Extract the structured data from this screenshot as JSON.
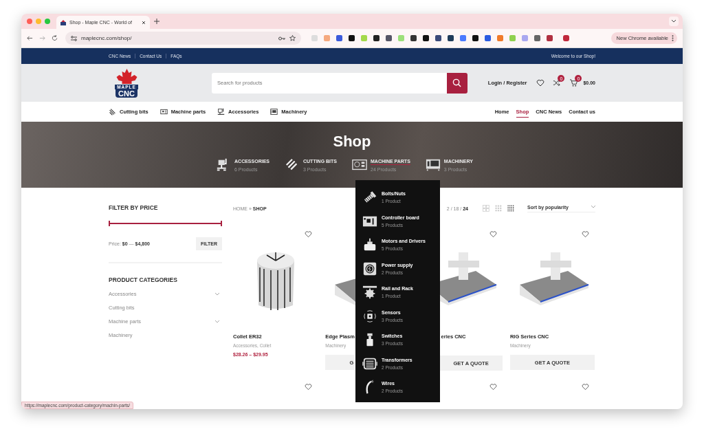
{
  "browser": {
    "tab_title": "Shop - Maple CNC - World of",
    "url": "maplecnc.com/shop/",
    "update_button": "New Chrome available"
  },
  "top_bar": {
    "links": [
      "CNC News",
      "Contact Us",
      "FAQs"
    ],
    "welcome": "Welcome to our Shop!"
  },
  "header": {
    "logo_top": "MAPLE",
    "logo_bottom": "CNC",
    "search": {
      "placeholder": "Search for products"
    },
    "account": "Login / Register",
    "compare_count": "0",
    "cart_count": "0",
    "cart_total": "$0.00"
  },
  "category_nav": [
    {
      "label": "Cutting bits"
    },
    {
      "label": "Machine parts"
    },
    {
      "label": "Accessories"
    },
    {
      "label": "Machinery"
    }
  ],
  "main_nav": [
    {
      "label": "Home",
      "selected": false
    },
    {
      "label": "Shop",
      "selected": true
    },
    {
      "label": "CNC News",
      "selected": false
    },
    {
      "label": "Contact us",
      "selected": false
    }
  ],
  "hero": {
    "title": "Shop",
    "categories": [
      {
        "name": "ACCESSORIES",
        "count": "6 Products",
        "selected": false
      },
      {
        "name": "CUTTING BITS",
        "count": "3 Products",
        "selected": false
      },
      {
        "name": "MACHINE PARTS",
        "count": "24 Products",
        "selected": true
      },
      {
        "name": "MACHINERY",
        "count": "3 Products",
        "selected": false
      }
    ]
  },
  "sidebar": {
    "filter_title": "FILTER BY PRICE",
    "range": {
      "level": 1
    },
    "price": "Price: **$0** — **$4,800**",
    "filter_button": "FILTER",
    "categories_title": "PRODUCT CATEGORIES",
    "categories": [
      {
        "label": "Accessories",
        "has_children": true
      },
      {
        "label": "Cutting bits",
        "has_children": false
      },
      {
        "label": "Machine parts",
        "has_children": true
      },
      {
        "label": "Machinery",
        "has_children": false
      }
    ]
  },
  "shop_bar": {
    "breadcrumb": [
      "HOME",
      "SHOP"
    ],
    "breadcrumb_separator": "»",
    "per_page": "2 / 18 / **24**",
    "views": [
      {
        "selected": false
      },
      {
        "selected": false
      },
      {
        "selected": true
      }
    ],
    "sort": "Sort by popularity"
  },
  "products": [
    {
      "kind": "collet",
      "wishlisted": false,
      "name": "Collet ER32",
      "categories": "Accessories, Collet",
      "price": "$28.26 – $29.95"
    },
    {
      "kind": "machine",
      "name": "Edge Plasm",
      "categories": "Machinery",
      "button": "G"
    },
    {
      "kind": "machine",
      "wishlisted": false,
      "name": "eries CNC",
      "button": "GET A QUOTE"
    },
    {
      "kind": "machine",
      "wishlisted": false,
      "name": "RIG Series CNC",
      "categories": "Machinery",
      "button": "GET A QUOTE"
    },
    {
      "kind": "part",
      "wishlisted": false
    },
    {
      "kind": "part"
    },
    {
      "kind": "part",
      "wishlisted": false
    },
    {
      "kind": "part",
      "wishlisted": false
    }
  ],
  "dropdown": {
    "items": [
      {
        "name": "Bolts/Nuts",
        "count": "1 Product"
      },
      {
        "name": "Controller board",
        "count": "5 Products"
      },
      {
        "name": "Motors and Drivers",
        "count": "5 Products"
      },
      {
        "name": "Power supply",
        "count": "2 Products"
      },
      {
        "name": "Rail and Rack",
        "count": "1 Product"
      },
      {
        "name": "Sensors",
        "count": "3 Products"
      },
      {
        "name": "Switches",
        "count": "3 Products"
      },
      {
        "name": "Transformers",
        "count": "2 Products"
      },
      {
        "name": "Wires",
        "count": "2 Products"
      }
    ]
  },
  "status_url": "https://maplecnc.com/product-category/machin-parts/"
}
